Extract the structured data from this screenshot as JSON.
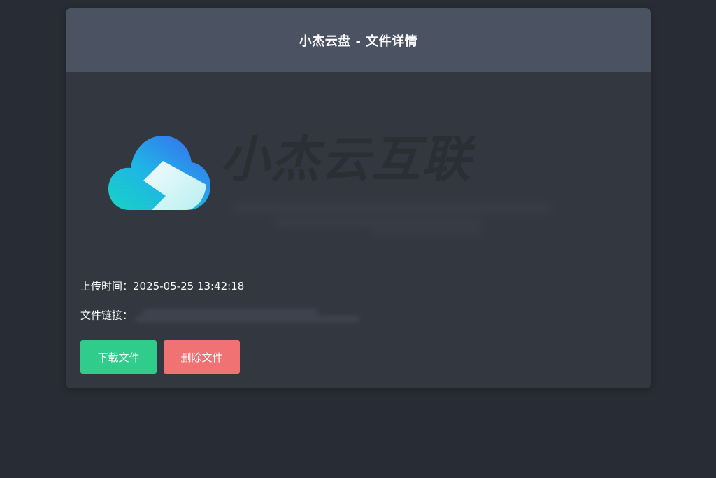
{
  "header": {
    "title": "小杰云盘 - 文件详情"
  },
  "preview": {
    "brand_text": "小杰云互联"
  },
  "info": {
    "upload_time_label": "上传时间：",
    "upload_time_value": "2025-05-25 13:42:18",
    "file_link_label": "文件链接："
  },
  "actions": {
    "download_label": "下载文件",
    "delete_label": "删除文件"
  },
  "colors": {
    "page_bg": "#282c34",
    "card_bg": "#333740",
    "header_bg": "#4b5363",
    "download_btn": "#2fcc8b",
    "delete_btn": "#f07273"
  }
}
